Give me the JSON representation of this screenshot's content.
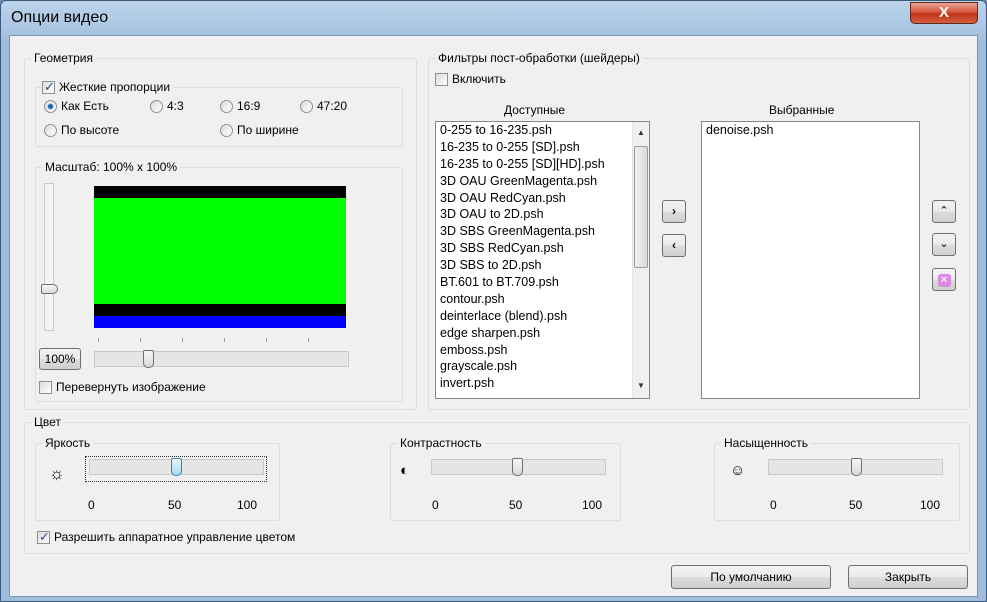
{
  "window": {
    "title": "Опции видео",
    "close_label": "X"
  },
  "geometry": {
    "group_label": "Геометрия",
    "keep_aspect_label": "Жесткие пропорции",
    "radio_as_is": "Как Есть",
    "radio_4_3": "4:3",
    "radio_16_9": "16:9",
    "radio_47_20": "47:20",
    "radio_by_height": "По высоте",
    "radio_by_width": "По ширине",
    "selected_ratio": "Как Есть",
    "scale_label": "Масштаб: 100% x 100%",
    "zoom_reset_label": "100%",
    "flip_label": "Перевернуть изображение"
  },
  "filters": {
    "group_label": "Фильтры пост-обработки (шейдеры)",
    "enable_label": "Включить",
    "available_header": "Доступные",
    "selected_header": "Выбранные",
    "available": [
      "0-255 to 16-235.psh",
      "16-235 to 0-255 [SD].psh",
      "16-235 to 0-255 [SD][HD].psh",
      "3D OAU GreenMagenta.psh",
      "3D OAU RedCyan.psh",
      "3D OAU to 2D.psh",
      "3D SBS GreenMagenta.psh",
      "3D SBS RedCyan.psh",
      "3D SBS to 2D.psh",
      "BT.601 to BT.709.psh",
      "contour.psh",
      "deinterlace (blend).psh",
      "edge sharpen.psh",
      "emboss.psh",
      "grayscale.psh",
      "invert.psh"
    ],
    "selected": [
      "denoise.psh"
    ]
  },
  "color": {
    "group_label": "Цвет",
    "brightness_label": "Яркость",
    "contrast_label": "Контрастность",
    "saturation_label": "Насыщенность",
    "brightness_value": 50,
    "contrast_value": 50,
    "saturation_value": 50,
    "tick_min": "0",
    "tick_mid": "50",
    "tick_max": "100",
    "hw_color_label": "Разрешить аппаратное управление цветом"
  },
  "footer": {
    "defaults_label": "По умолчанию",
    "close_label": "Закрыть"
  },
  "colors": {
    "preview_green": "#00ff00",
    "preview_blue": "#0000ff",
    "bar_black": "#000000",
    "title_bar": "#a9c5e3"
  },
  "icons": [
    "close-icon",
    "sun-icon",
    "contrast-icon",
    "saturation-icon",
    "arrow-right-icon",
    "arrow-left-icon",
    "chevron-up-icon",
    "chevron-down-icon",
    "remove-icon"
  ]
}
